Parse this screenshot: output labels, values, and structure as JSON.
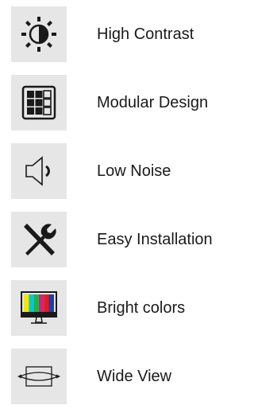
{
  "features": [
    {
      "icon": "brightness-icon",
      "label": "High Contrast"
    },
    {
      "icon": "modular-grid-icon",
      "label": "Modular Design"
    },
    {
      "icon": "speaker-icon",
      "label": "Low Noise"
    },
    {
      "icon": "tools-icon",
      "label": "Easy Installation"
    },
    {
      "icon": "color-monitor-icon",
      "label": "Bright colors"
    },
    {
      "icon": "wide-view-icon",
      "label": "Wide View"
    }
  ],
  "colors": {
    "tile_background": "#e6e6e6",
    "icon": "#1a1a1a",
    "text": "#1a1a1a",
    "color_bars": [
      "#f5e600",
      "#00c8d8",
      "#22b04a",
      "#d81f7a",
      "#e01b22",
      "#1c3fa8"
    ]
  }
}
